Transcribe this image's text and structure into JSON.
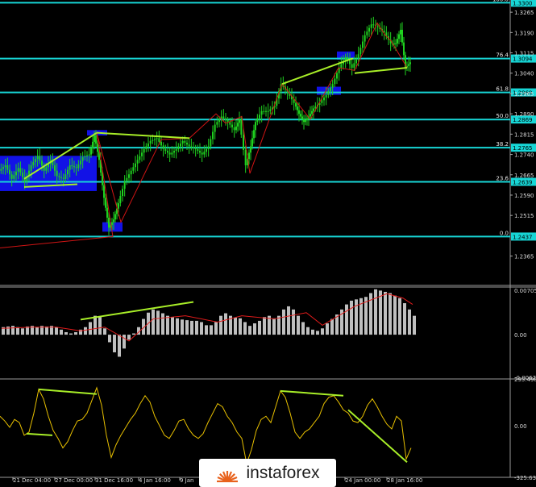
{
  "watermark": {
    "text": "instaforex",
    "logo": "instaforex-logo",
    "logo_color": "#e8621d"
  },
  "colors": {
    "background": "#000000",
    "grid": "#3a3a3a",
    "fib_line": "#17d6d6",
    "candle": "#1fd11f",
    "zigzag": "#d01414",
    "trendline": "#a8ee28",
    "zone": "#1414ff",
    "histogram": "#bfbfbf",
    "signal": "#e21b1b",
    "oscillator": "#e8c000"
  },
  "chart_data": [
    {
      "type": "candlestick",
      "symbol_panel": "price",
      "ylim": [
        1.234,
        1.331
      ],
      "y_ticks": [
        "1.3265",
        "1.3190",
        "1.3115",
        "1.3040",
        "1.2965",
        "1.2890",
        "1.2815",
        "1.2740",
        "1.2665",
        "1.2590",
        "1.2515",
        "1.2365"
      ],
      "x_ticks": [
        "21 Dec 04:00",
        "27 Dec 00:00",
        "31 Dec 16:00",
        "4 Jan 16:00",
        "9 Jan",
        "24 Jan 00:00",
        "28 Jan 16:00"
      ],
      "fib_levels": [
        {
          "level": "100.0",
          "price": 1.33,
          "label": "1.3300"
        },
        {
          "level": "76.4",
          "price": 1.3094,
          "label": "1.3094"
        },
        {
          "level": "61.8",
          "price": 1.2969,
          "label": "1.2969"
        },
        {
          "level": "50.0",
          "price": 1.2869,
          "label": "1.2869"
        },
        {
          "level": "38.2",
          "price": 1.2765,
          "label": "1.2765"
        },
        {
          "level": "23.6",
          "price": 1.2639,
          "label": "1.2639"
        },
        {
          "level": "0.0",
          "price": 1.2437,
          "label": "1.2437"
        }
      ],
      "close_path": [
        [
          0,
          1.268
        ],
        [
          8,
          1.27
        ],
        [
          16,
          1.265
        ],
        [
          24,
          1.269
        ],
        [
          32,
          1.264
        ],
        [
          40,
          1.27
        ],
        [
          48,
          1.2735
        ],
        [
          56,
          1.268
        ],
        [
          64,
          1.272
        ],
        [
          72,
          1.266
        ],
        [
          80,
          1.265
        ],
        [
          88,
          1.27
        ],
        [
          96,
          1.269
        ],
        [
          104,
          1.273
        ],
        [
          112,
          1.274
        ],
        [
          118,
          1.281
        ],
        [
          124,
          1.272
        ],
        [
          130,
          1.258
        ],
        [
          136,
          1.247
        ],
        [
          142,
          1.25
        ],
        [
          148,
          1.256
        ],
        [
          156,
          1.264
        ],
        [
          164,
          1.268
        ],
        [
          172,
          1.272
        ],
        [
          180,
          1.276
        ],
        [
          188,
          1.279
        ],
        [
          196,
          1.28
        ],
        [
          204,
          1.276
        ],
        [
          212,
          1.274
        ],
        [
          220,
          1.276
        ],
        [
          228,
          1.279
        ],
        [
          236,
          1.277
        ],
        [
          244,
          1.276
        ],
        [
          252,
          1.274
        ],
        [
          260,
          1.277
        ],
        [
          268,
          1.285
        ],
        [
          276,
          1.288
        ],
        [
          284,
          1.286
        ],
        [
          292,
          1.283
        ],
        [
          298,
          1.287
        ],
        [
          306,
          1.27
        ],
        [
          312,
          1.277
        ],
        [
          318,
          1.286
        ],
        [
          326,
          1.29
        ],
        [
          334,
          1.29
        ],
        [
          342,
          1.292
        ],
        [
          350,
          1.3
        ],
        [
          358,
          1.297
        ],
        [
          366,
          1.293
        ],
        [
          372,
          1.289
        ],
        [
          378,
          1.286
        ],
        [
          384,
          1.288
        ],
        [
          390,
          1.291
        ],
        [
          398,
          1.293
        ],
        [
          406,
          1.296
        ],
        [
          414,
          1.3
        ],
        [
          422,
          1.306
        ],
        [
          430,
          1.31
        ],
        [
          438,
          1.306
        ],
        [
          446,
          1.311
        ],
        [
          454,
          1.318
        ],
        [
          462,
          1.322
        ],
        [
          470,
          1.321
        ],
        [
          478,
          1.319
        ],
        [
          486,
          1.315
        ],
        [
          492,
          1.315
        ],
        [
          498,
          1.32
        ],
        [
          504,
          1.306
        ],
        [
          510,
          1.308
        ]
      ],
      "zigzag": [
        [
          0,
          1.2395
        ],
        [
          140,
          1.2437
        ],
        [
          120,
          1.282
        ],
        [
          150,
          1.249
        ],
        [
          200,
          1.2795
        ],
        [
          235,
          1.28
        ],
        [
          268,
          1.289
        ],
        [
          280,
          1.2855
        ],
        [
          300,
          1.288
        ],
        [
          310,
          1.267
        ],
        [
          350,
          1.3
        ],
        [
          385,
          1.287
        ],
        [
          420,
          1.306
        ],
        [
          440,
          1.305
        ],
        [
          468,
          1.3225
        ],
        [
          478,
          1.318
        ],
        [
          485,
          1.316
        ],
        [
          505,
          1.306
        ]
      ],
      "trendlines": [
        [
          [
            30,
            1.265
          ],
          [
            120,
            1.282
          ]
        ],
        [
          [
            120,
            1.282
          ],
          [
            235,
            1.28
          ]
        ],
        [
          [
            30,
            1.262
          ],
          [
            96,
            1.263
          ]
        ],
        [
          [
            350,
            1.3
          ],
          [
            438,
            1.3095
          ]
        ],
        [
          [
            440,
            1.304
          ],
          [
            505,
            1.306
          ]
        ]
      ],
      "zones": [
        {
          "x1": 0,
          "x2": 120,
          "y1": 1.2605,
          "y2": 1.2735
        },
        {
          "x1": 108,
          "x2": 133,
          "y1": 1.281,
          "y2": 1.283
        },
        {
          "x1": 127,
          "x2": 152,
          "y1": 1.2455,
          "y2": 1.249
        },
        {
          "x1": 393,
          "x2": 423,
          "y1": 1.296,
          "y2": 1.299
        },
        {
          "x1": 418,
          "x2": 440,
          "y1": 1.309,
          "y2": 1.312
        }
      ]
    },
    {
      "type": "bar",
      "symbol_panel": "macd",
      "ylim": [
        -0.00677,
        0.00705
      ],
      "y_ticks": [
        "0.00705",
        "0.00",
        "-0.00677"
      ],
      "histogram": [
        [
          2,
          0.0012
        ],
        [
          8,
          0.0013
        ],
        [
          14,
          0.0014
        ],
        [
          20,
          0.0012
        ],
        [
          26,
          0.001
        ],
        [
          32,
          0.0013
        ],
        [
          38,
          0.0014
        ],
        [
          44,
          0.0012
        ],
        [
          50,
          0.0014
        ],
        [
          56,
          0.0013
        ],
        [
          62,
          0.0014
        ],
        [
          68,
          0.0012
        ],
        [
          74,
          0.0008
        ],
        [
          80,
          0.0004
        ],
        [
          86,
          0.0002
        ],
        [
          92,
          0.0004
        ],
        [
          98,
          0.0008
        ],
        [
          104,
          0.0012
        ],
        [
          110,
          0.002
        ],
        [
          116,
          0.003
        ],
        [
          122,
          0.0028
        ],
        [
          128,
          0.001
        ],
        [
          134,
          -0.0012
        ],
        [
          140,
          -0.0028
        ],
        [
          146,
          -0.0035
        ],
        [
          152,
          -0.0022
        ],
        [
          158,
          -0.0008
        ],
        [
          164,
          0.0002
        ],
        [
          170,
          0.0012
        ],
        [
          176,
          0.0025
        ],
        [
          182,
          0.0035
        ],
        [
          188,
          0.004
        ],
        [
          194,
          0.0038
        ],
        [
          200,
          0.0034
        ],
        [
          206,
          0.003
        ],
        [
          212,
          0.0028
        ],
        [
          218,
          0.0026
        ],
        [
          224,
          0.0024
        ],
        [
          230,
          0.0023
        ],
        [
          236,
          0.0022
        ],
        [
          242,
          0.0022
        ],
        [
          248,
          0.002
        ],
        [
          254,
          0.0015
        ],
        [
          260,
          0.0015
        ],
        [
          266,
          0.002
        ],
        [
          272,
          0.003
        ],
        [
          278,
          0.0034
        ],
        [
          284,
          0.003
        ],
        [
          290,
          0.0027
        ],
        [
          296,
          0.0026
        ],
        [
          302,
          0.002
        ],
        [
          308,
          0.0014
        ],
        [
          314,
          0.0018
        ],
        [
          320,
          0.0022
        ],
        [
          326,
          0.0028
        ],
        [
          332,
          0.003
        ],
        [
          338,
          0.0026
        ],
        [
          344,
          0.003
        ],
        [
          350,
          0.004
        ],
        [
          356,
          0.0045
        ],
        [
          362,
          0.004
        ],
        [
          368,
          0.003
        ],
        [
          374,
          0.002
        ],
        [
          380,
          0.0012
        ],
        [
          386,
          0.0008
        ],
        [
          392,
          0.0006
        ],
        [
          398,
          0.001
        ],
        [
          404,
          0.0018
        ],
        [
          410,
          0.0025
        ],
        [
          416,
          0.0032
        ],
        [
          422,
          0.004
        ],
        [
          428,
          0.0048
        ],
        [
          434,
          0.0054
        ],
        [
          440,
          0.0056
        ],
        [
          446,
          0.0058
        ],
        [
          452,
          0.006
        ],
        [
          458,
          0.0066
        ],
        [
          464,
          0.0072
        ],
        [
          470,
          0.007
        ],
        [
          476,
          0.0068
        ],
        [
          482,
          0.0066
        ],
        [
          488,
          0.0062
        ],
        [
          494,
          0.0058
        ],
        [
          500,
          0.005
        ],
        [
          506,
          0.004
        ],
        [
          512,
          0.003
        ]
      ],
      "signal": [
        [
          2,
          0.001
        ],
        [
          40,
          0.0012
        ],
        [
          70,
          0.0012
        ],
        [
          100,
          0.0006
        ],
        [
          130,
          0.0012
        ],
        [
          160,
          -0.001
        ],
        [
          190,
          0.0025
        ],
        [
          230,
          0.003
        ],
        [
          270,
          0.002
        ],
        [
          300,
          0.003
        ],
        [
          340,
          0.0025
        ],
        [
          380,
          0.0035
        ],
        [
          400,
          0.0015
        ],
        [
          440,
          0.0045
        ],
        [
          480,
          0.0065
        ],
        [
          500,
          0.0058
        ],
        [
          512,
          0.0048
        ]
      ],
      "trendline": [
        [
          100,
          0.0024
        ],
        [
          240,
          0.0052
        ]
      ]
    },
    {
      "type": "line",
      "symbol_panel": "oscillator",
      "ylim": [
        -325.63,
        295.4989
      ],
      "y_ticks": [
        "295.4989",
        "0.00",
        "-325.630"
      ],
      "series": [
        [
          [
            0,
            60
          ],
          [
            6,
            30
          ],
          [
            12,
            -10
          ],
          [
            18,
            40
          ],
          [
            24,
            20
          ],
          [
            30,
            -60
          ],
          [
            36,
            -40
          ],
          [
            42,
            80
          ],
          [
            48,
            230
          ],
          [
            54,
            170
          ],
          [
            60,
            60
          ],
          [
            66,
            -30
          ],
          [
            72,
            -80
          ],
          [
            78,
            -140
          ],
          [
            84,
            -100
          ],
          [
            90,
            -30
          ],
          [
            96,
            30
          ],
          [
            102,
            40
          ],
          [
            108,
            80
          ],
          [
            114,
            160
          ],
          [
            120,
            240
          ],
          [
            126,
            130
          ],
          [
            132,
            -60
          ],
          [
            138,
            -200
          ],
          [
            144,
            -120
          ],
          [
            150,
            -60
          ],
          [
            156,
            -10
          ],
          [
            162,
            40
          ],
          [
            168,
            80
          ],
          [
            174,
            140
          ],
          [
            180,
            190
          ],
          [
            186,
            150
          ],
          [
            192,
            60
          ],
          [
            198,
            0
          ],
          [
            204,
            -60
          ],
          [
            210,
            -80
          ],
          [
            216,
            -30
          ],
          [
            222,
            30
          ],
          [
            228,
            40
          ],
          [
            234,
            -20
          ],
          [
            240,
            -60
          ],
          [
            246,
            -80
          ],
          [
            252,
            -50
          ],
          [
            258,
            20
          ],
          [
            264,
            80
          ],
          [
            270,
            140
          ],
          [
            276,
            120
          ],
          [
            282,
            60
          ],
          [
            288,
            20
          ],
          [
            294,
            -40
          ],
          [
            300,
            -80
          ],
          [
            306,
            -240
          ],
          [
            312,
            -150
          ],
          [
            318,
            -30
          ],
          [
            324,
            40
          ],
          [
            330,
            60
          ],
          [
            336,
            20
          ],
          [
            342,
            120
          ],
          [
            348,
            220
          ],
          [
            354,
            180
          ],
          [
            360,
            80
          ],
          [
            366,
            -40
          ],
          [
            372,
            -80
          ],
          [
            378,
            -40
          ],
          [
            384,
            -20
          ],
          [
            390,
            20
          ],
          [
            396,
            60
          ],
          [
            402,
            140
          ],
          [
            408,
            180
          ],
          [
            414,
            190
          ],
          [
            420,
            150
          ],
          [
            426,
            100
          ],
          [
            432,
            80
          ],
          [
            438,
            30
          ],
          [
            444,
            20
          ],
          [
            450,
            60
          ],
          [
            456,
            130
          ],
          [
            462,
            170
          ],
          [
            468,
            120
          ],
          [
            474,
            60
          ],
          [
            480,
            10
          ],
          [
            486,
            -20
          ],
          [
            492,
            60
          ],
          [
            498,
            30
          ],
          [
            504,
            -210
          ],
          [
            510,
            -140
          ]
        ]
      ],
      "trendlines": [
        [
          [
            33,
            -50
          ],
          [
            65,
            -60
          ]
        ],
        [
          [
            48,
            230
          ],
          [
            120,
            200
          ]
        ],
        [
          [
            348,
            220
          ],
          [
            426,
            190
          ]
        ],
        [
          [
            432,
            100
          ],
          [
            505,
            -230
          ]
        ]
      ]
    }
  ]
}
